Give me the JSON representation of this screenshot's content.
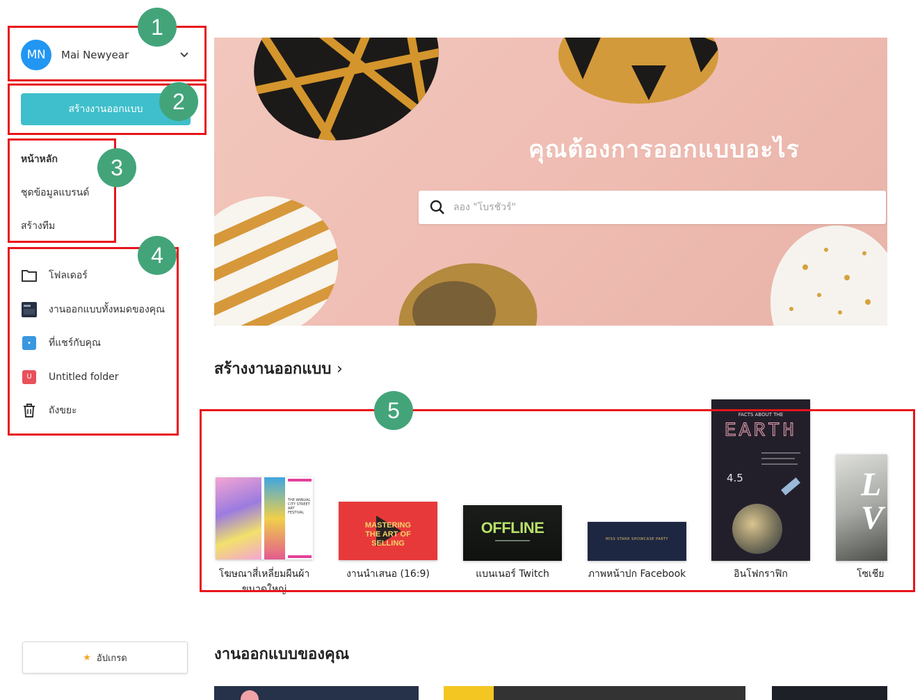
{
  "sidebar": {
    "avatar_initials": "MN",
    "user_name": "Mai Newyear",
    "create_button": "สร้างงานออกแบบ",
    "nav": [
      "หน้าหลัก",
      "ชุดข้อมูลแบรนด์",
      "สร้างทีม"
    ],
    "folders": [
      {
        "label": "โฟลเดอร์",
        "icon": "folder-icon"
      },
      {
        "label": "งานออกแบบทั้งหมดของคุณ",
        "icon": "designs-icon"
      },
      {
        "label": "ที่แชร์กับคุณ",
        "icon": "shared-icon"
      },
      {
        "label": "Untitled folder",
        "icon": "untitled-folder-icon",
        "tag": "U"
      },
      {
        "label": "ถังขยะ",
        "icon": "trash-icon"
      }
    ],
    "upgrade_button": "อัปเกรด"
  },
  "hero": {
    "title": "คุณต้องการออกแบบอะไร",
    "search_placeholder": "ลอง \"โบรชัวร์\""
  },
  "create_section": {
    "title": "สร้างงานออกแบบ",
    "arrow": "›",
    "templates": [
      {
        "label": "โฆษณาสี่เหลี่ยมผืนผ้า",
        "label2": "ขนาดใหญ่",
        "thumb_text": "THE ANNUAL CITY STREET ART FESTIVAL"
      },
      {
        "label": "งานนำเสนอ (16:9)",
        "thumb_text": "MASTERING THE ART OF SELLING"
      },
      {
        "label": "แบนเนอร์ Twitch",
        "thumb_text": "OFFLINE"
      },
      {
        "label": "ภาพหน้าปก Facebook",
        "thumb_text": "MISS STARR SHOWCASE PARTY"
      },
      {
        "label": "อินโฟกราฟิก",
        "thumb_heading": "FACTS ABOUT THE",
        "thumb_title": "EARTH",
        "thumb_number": "4.5"
      },
      {
        "label": "โซเชีย"
      }
    ]
  },
  "my_designs": {
    "title": "งานออกแบบของคุณ"
  },
  "annotations": [
    "1",
    "2",
    "3",
    "4",
    "5"
  ],
  "colors": {
    "accent": "#3fbfcb",
    "avatar": "#2196f3",
    "annotation_box": "#e8141b",
    "annotation_badge": "#43a47a",
    "hero_bg": "#f2c7bd"
  }
}
